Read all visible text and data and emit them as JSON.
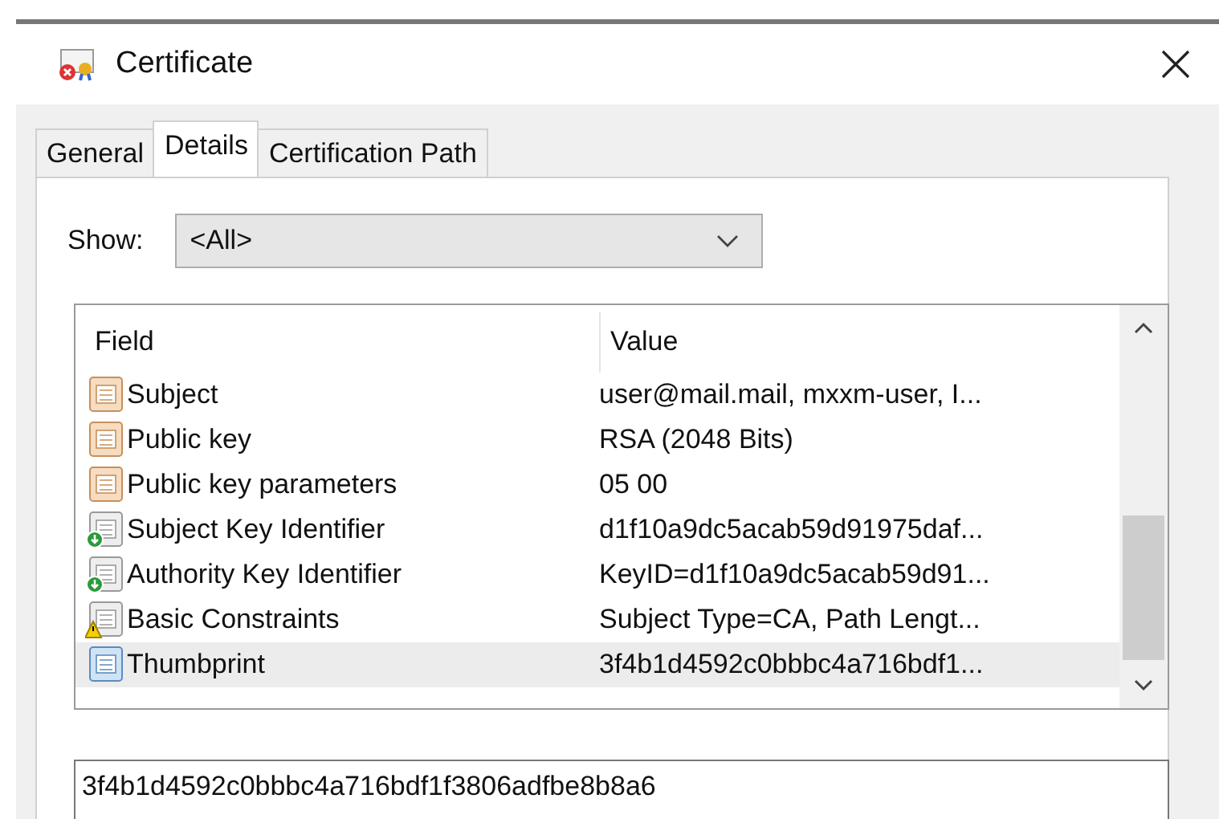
{
  "window": {
    "title": "Certificate"
  },
  "tabs": [
    {
      "label": "General",
      "selected": false
    },
    {
      "label": "Details",
      "selected": true
    },
    {
      "label": "Certification Path",
      "selected": false
    }
  ],
  "show": {
    "label": "Show:",
    "value": "<All>"
  },
  "table": {
    "columns": [
      "Field",
      "Value"
    ],
    "rows": [
      {
        "kind": "property",
        "field": "Subject",
        "value": "user@mail.mail, mxxm-user, I...",
        "selected": false
      },
      {
        "kind": "property",
        "field": "Public key",
        "value": "RSA (2048 Bits)",
        "selected": false
      },
      {
        "kind": "property",
        "field": "Public key parameters",
        "value": "05 00",
        "selected": false
      },
      {
        "kind": "extension",
        "field": "Subject Key Identifier",
        "value": "d1f10a9dc5acab59d91975daf...",
        "selected": false
      },
      {
        "kind": "extension",
        "field": "Authority Key Identifier",
        "value": "KeyID=d1f10a9dc5acab59d91...",
        "selected": false
      },
      {
        "kind": "critical",
        "field": "Basic Constraints",
        "value": "Subject Type=CA, Path Lengt...",
        "selected": false
      },
      {
        "kind": "thumbprint",
        "field": "Thumbprint",
        "value": "3f4b1d4592c0bbbc4a716bdf1...",
        "selected": true
      }
    ]
  },
  "detail": {
    "value": "3f4b1d4592c0bbbc4a716bdf1f3806adfbe8b8a6"
  }
}
